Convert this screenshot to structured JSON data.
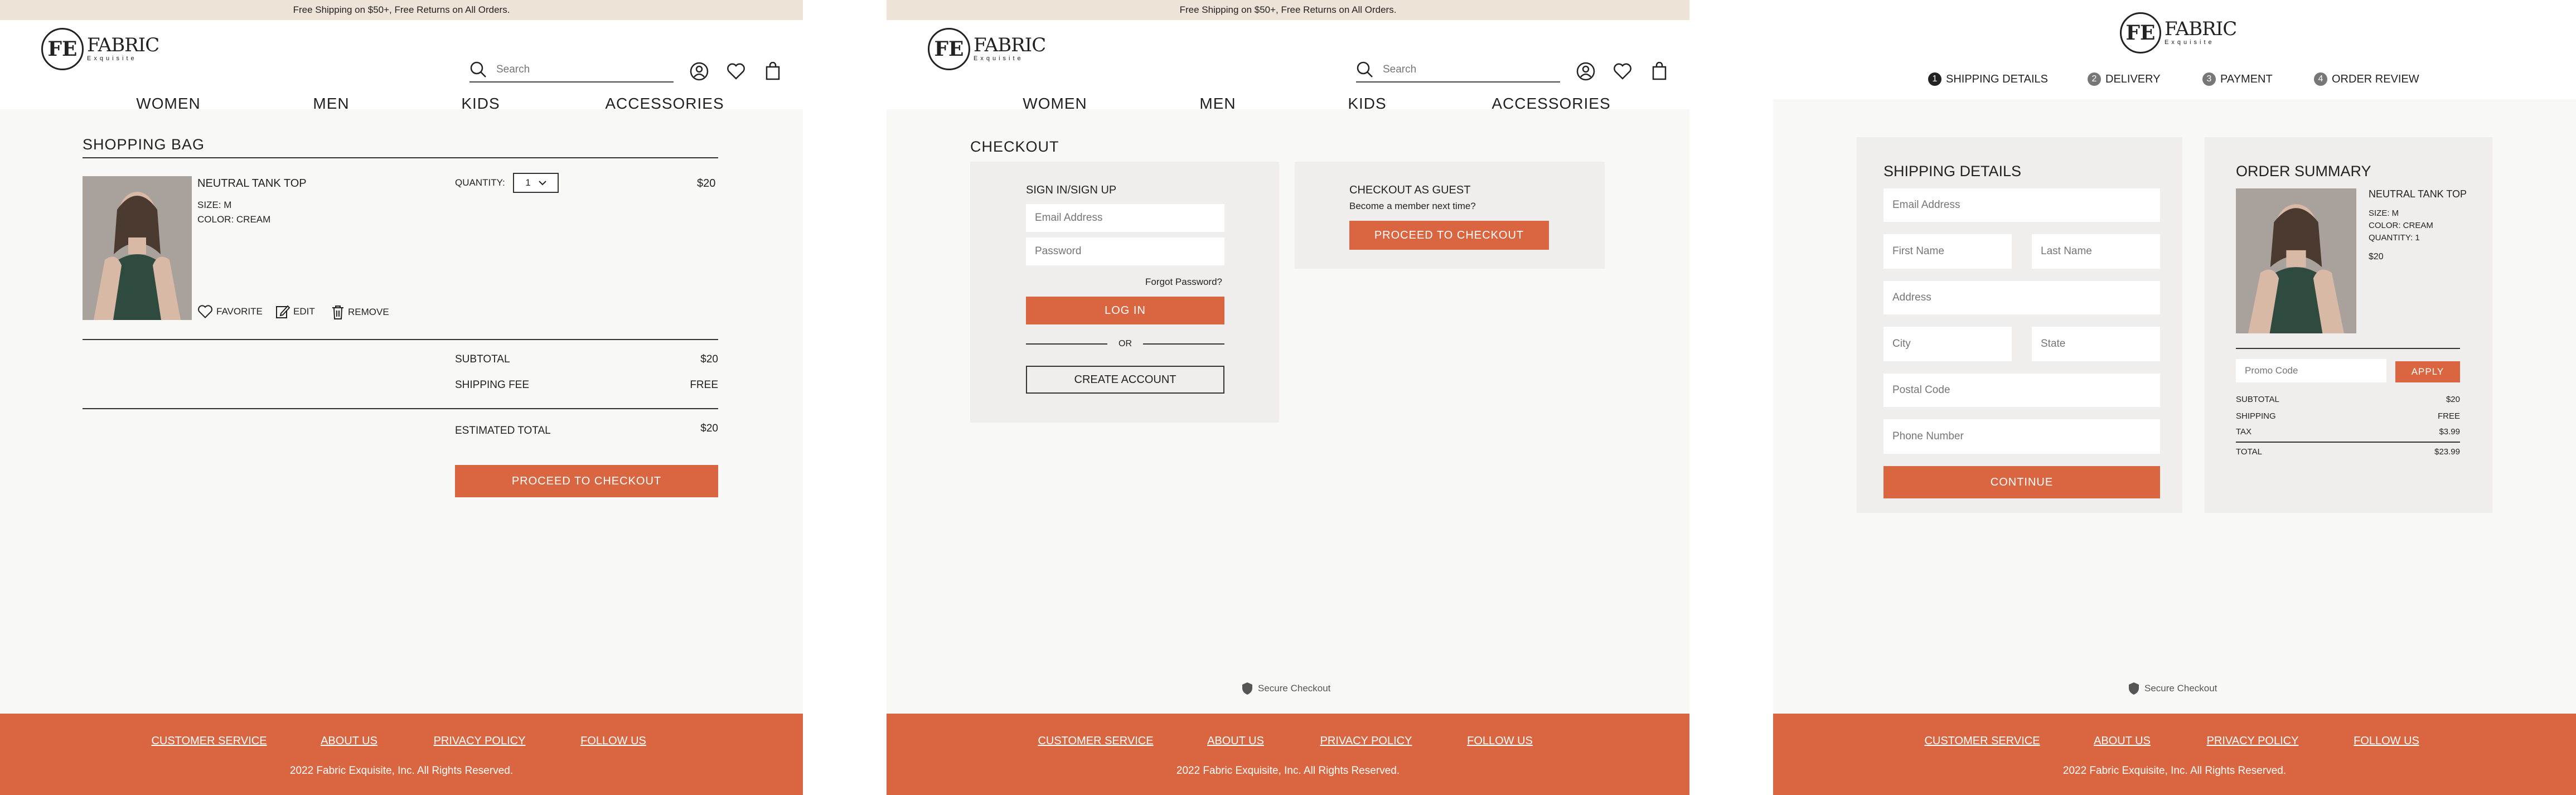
{
  "promo": "Free Shipping on $50+, Free Returns on All Orders.",
  "brand": {
    "name": "FABRIC",
    "sub": "Exquisite",
    "mark": "FE"
  },
  "search_placeholder": "Search",
  "nav": [
    "WOMEN",
    "MEN",
    "KIDS",
    "ACCESSORIES"
  ],
  "icons": [
    "search-icon",
    "account-icon",
    "heart-icon",
    "bag-icon"
  ],
  "colors": {
    "accent": "#d96640",
    "promo_bg": "#ede3d7",
    "panel_bg": "#efeeec",
    "page_bg": "#f8f8f7"
  },
  "bag": {
    "title": "SHOPPING BAG",
    "item_name": "NEUTRAL TANK TOP",
    "size": "SIZE: M",
    "color": "COLOR: CREAM",
    "quantity_label": "QUANTITY:",
    "quantity_value": "1",
    "price": "$20",
    "actions": [
      "FAVORITE",
      "EDIT",
      "REMOVE"
    ],
    "subtotal_label": "SUBTOTAL",
    "subtotal_value": "$20",
    "shipping_label": "SHIPPING FEE",
    "shipping_value": "FREE",
    "total_label": "ESTIMATED TOTAL",
    "total_value": "$20",
    "checkout_button": "PROCEED TO CHECKOUT"
  },
  "checkout": {
    "title": "CHECKOUT",
    "signin_title": "SIGN IN/SIGN UP",
    "email_placeholder": "Email Address",
    "password_placeholder": "Password",
    "forgot": "Forgot Password?",
    "login_button": "LOG IN",
    "or": "OR",
    "create_button": "CREATE ACCOUNT",
    "guest_title": "CHECKOUT AS GUEST",
    "guest_sub": "Become a member next time?",
    "guest_button": "PROCEED TO CHECKOUT"
  },
  "secure": "Secure Checkout",
  "steps": [
    {
      "num": "1",
      "label": "SHIPPING DETAILS"
    },
    {
      "num": "2",
      "label": "DELIVERY"
    },
    {
      "num": "3",
      "label": "PAYMENT"
    },
    {
      "num": "4",
      "label": "ORDER REVIEW"
    }
  ],
  "shipping": {
    "title": "SHIPPING DETAILS",
    "email": "Email Address",
    "first": "First Name",
    "last": "Last Name",
    "address": "Address",
    "city": "City",
    "state": "State",
    "postal": "Postal Code",
    "phone": "Phone Number",
    "continue": "CONTINUE"
  },
  "summary": {
    "title": "ORDER SUMMARY",
    "item_name": "NEUTRAL TANK TOP",
    "size": "SIZE: M",
    "color": "COLOR: CREAM",
    "quantity": "QUANTITY: 1",
    "price": "$20",
    "promo_placeholder": "Promo Code",
    "apply": "APPLY",
    "subtotal_label": "SUBTOTAL",
    "subtotal_value": "$20",
    "shipping_label": "SHIPPING",
    "shipping_value": "FREE",
    "tax_label": "TAX",
    "tax_value": "$3.99",
    "total_label": "TOTAL",
    "total_value": "$23.99"
  },
  "footer": {
    "links": [
      "CUSTOMER SERVICE",
      "ABOUT US",
      "PRIVACY POLICY",
      "FOLLOW US"
    ],
    "copyright": "2022 Fabric Exquisite, Inc. All Rights Reserved."
  }
}
